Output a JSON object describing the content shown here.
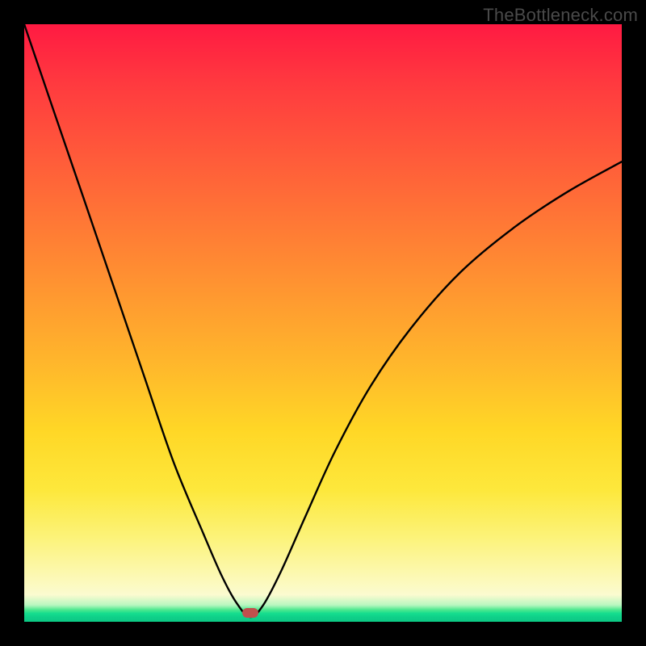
{
  "watermark": "TheBottleneck.com",
  "marker": {
    "x_frac": 0.378,
    "y_frac": 0.985
  },
  "chart_data": {
    "type": "line",
    "title": "",
    "xlabel": "",
    "ylabel": "",
    "xlim": [
      0,
      1
    ],
    "ylim": [
      0,
      1
    ],
    "series": [
      {
        "name": "curve",
        "x": [
          0.0,
          0.05,
          0.1,
          0.15,
          0.2,
          0.25,
          0.3,
          0.33,
          0.355,
          0.378,
          0.4,
          0.43,
          0.47,
          0.52,
          0.58,
          0.65,
          0.73,
          0.82,
          0.91,
          1.0
        ],
        "y": [
          1.0,
          0.853,
          0.707,
          0.56,
          0.413,
          0.267,
          0.147,
          0.078,
          0.032,
          0.008,
          0.028,
          0.085,
          0.175,
          0.285,
          0.395,
          0.495,
          0.585,
          0.66,
          0.72,
          0.77
        ]
      }
    ],
    "background_gradient": {
      "stops": [
        {
          "pos": 0.0,
          "color": "#ff1a42"
        },
        {
          "pos": 0.5,
          "color": "#ffa830"
        },
        {
          "pos": 0.8,
          "color": "#fcee60"
        },
        {
          "pos": 0.96,
          "color": "#fbfbd0"
        },
        {
          "pos": 1.0,
          "color": "#0cc884"
        }
      ]
    },
    "marker": {
      "x": 0.378,
      "y": 0.015,
      "color": "#c0504d"
    }
  }
}
